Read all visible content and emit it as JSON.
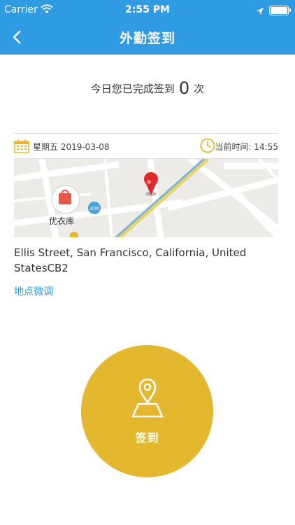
{
  "status_bar": {
    "carrier": "Carrier",
    "time": "2:55 PM"
  },
  "nav": {
    "title": "外勤签到"
  },
  "summary": {
    "prefix": "今日您已完成签到",
    "count": "0",
    "suffix": "次"
  },
  "date_row": {
    "date": "星期五 2019-03-08",
    "time_label": "当前时间: 14:55"
  },
  "map": {
    "poi_label": "优衣库",
    "badge": "ATM"
  },
  "address": {
    "text": "Ellis Street, San Francisco, California, United StatesCB2"
  },
  "adjust_link": {
    "label": "地点微调"
  },
  "checkin_button": {
    "label": "签到",
    "color": "#e3b82f"
  },
  "colors": {
    "primary": "#2e9be3",
    "accent": "#e3b82f"
  }
}
